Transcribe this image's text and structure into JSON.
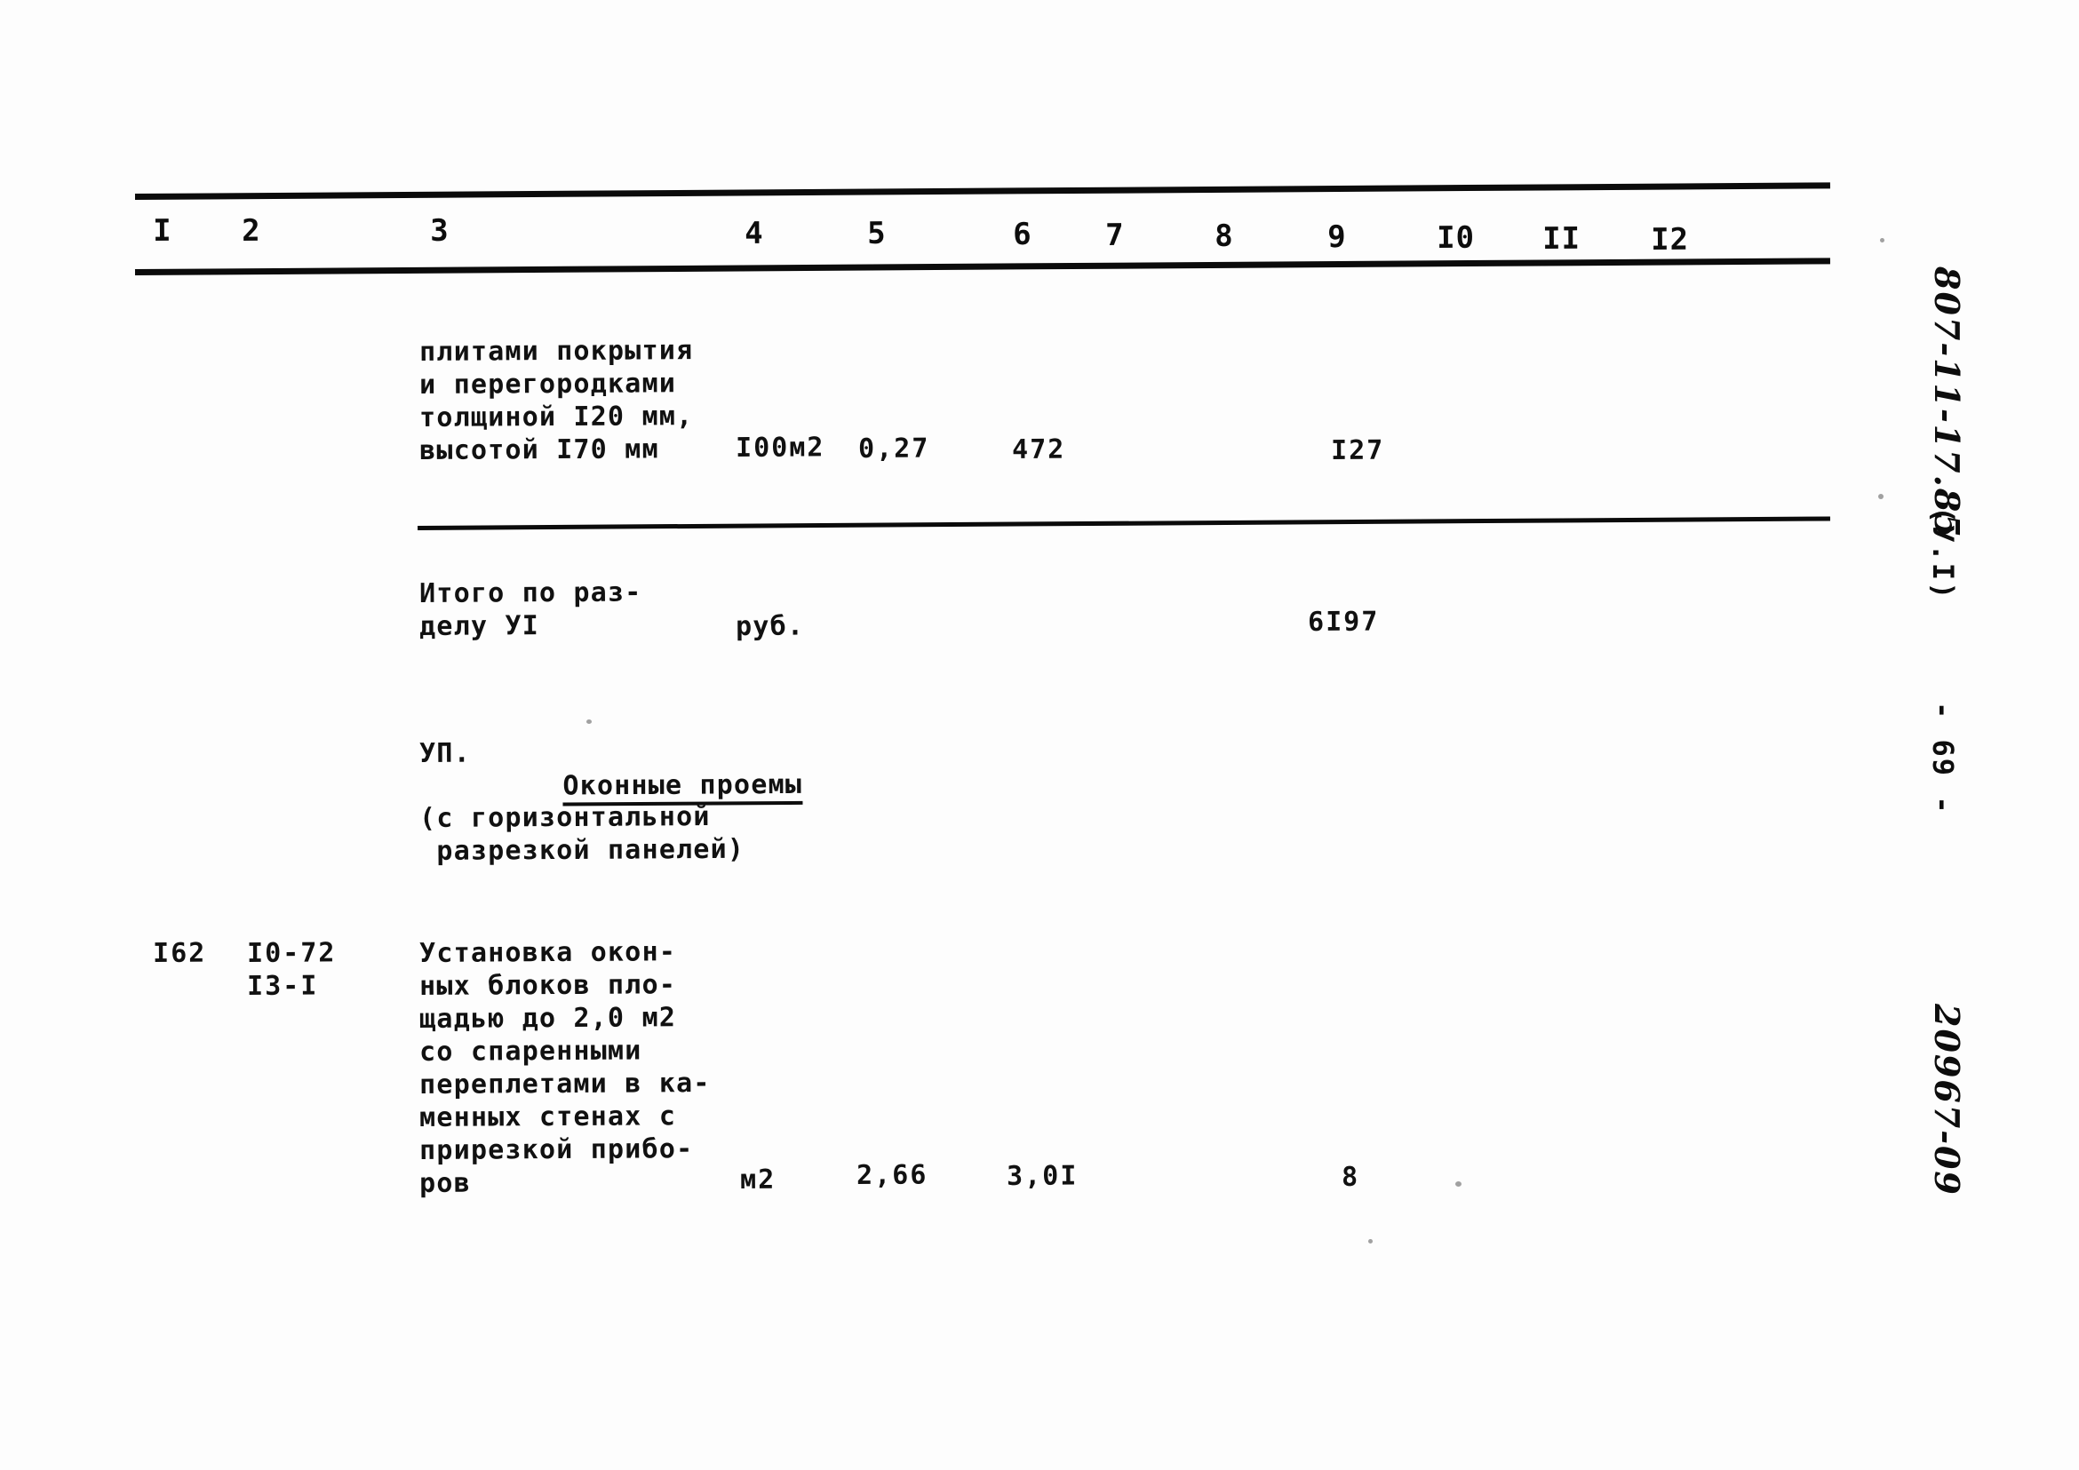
{
  "document": {
    "kind": "scanned-typewritten-table",
    "page_label": "- 69 -",
    "volume_note": "(У.I)",
    "catalog_code_handwritten": "807-11-17.85",
    "archive_code_handwritten": "20967-09"
  },
  "table": {
    "column_headers": [
      "I",
      "2",
      "3",
      "4",
      "5",
      "6",
      "7",
      "8",
      "9",
      "I0",
      "II",
      "I2"
    ],
    "rows": [
      {
        "name": "continued-item-row",
        "col1": "",
        "col2": "",
        "description_lines": [
          "плитами покрытия",
          "и перегородками",
          "толщиной I20 мм,",
          "высотой I70 мм"
        ],
        "col4_unit": "I00м2",
        "col5": "0,27",
        "col6": "472",
        "col9": "I27"
      },
      {
        "name": "section-total-row",
        "description_lines": [
          "Итого по раз-",
          "делу УI"
        ],
        "col4_unit": "руб.",
        "col9": "6I97"
      },
      {
        "name": "section-heading-row",
        "heading_prefix": "УП.",
        "heading_underlined": "Оконные проемы",
        "subtitle_lines": [
          "(с горизонтальной",
          " разрезкой панелей)"
        ]
      },
      {
        "name": "item-162-row",
        "col1": "I62",
        "col2_lines": [
          "I0-72",
          "I3-I"
        ],
        "description_lines": [
          "Установка окон-",
          "ных блоков пло-",
          "щадью до 2,0 м2",
          "со спаренными",
          "переплетами в ка-",
          "менных стенах с",
          "прирезкой прибо-",
          "ров"
        ],
        "col4_unit": "м2",
        "col5": "2,66",
        "col6": "3,0I",
        "col9": "8"
      }
    ]
  }
}
